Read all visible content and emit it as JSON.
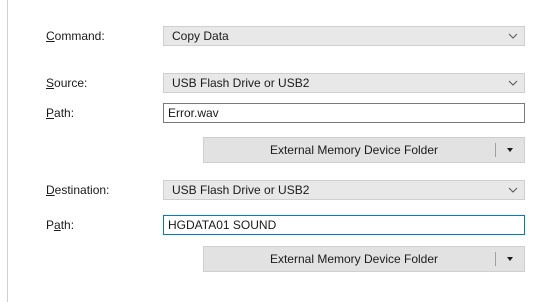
{
  "command": {
    "label_mnemonic": "C",
    "label_rest": "ommand:",
    "value": "Copy Data"
  },
  "source": {
    "label_mnemonic": "S",
    "label_rest": "ource:",
    "device": "USB Flash Drive or USB2",
    "path_label_mnemonic": "P",
    "path_label_rest": "ath:",
    "path_value": "Error.wav",
    "folder_button": "External Memory Device Folder"
  },
  "destination": {
    "label_mnemonic": "D",
    "label_rest": "estination:",
    "device": "USB Flash Drive or USB2",
    "path_label_pre": "P",
    "path_label_mnemonic": "a",
    "path_label_rest": "th:",
    "path_value": "HGDATA01 SOUND",
    "folder_button": "External Memory Device Folder"
  },
  "icons": {
    "dropdown": "chevron-down-icon",
    "split_arrow": "triangle-down-icon"
  },
  "colors": {
    "focus_border": "#0078d7",
    "combo_bg": "#e8e8e8",
    "button_bg": "#e2e2e2"
  }
}
